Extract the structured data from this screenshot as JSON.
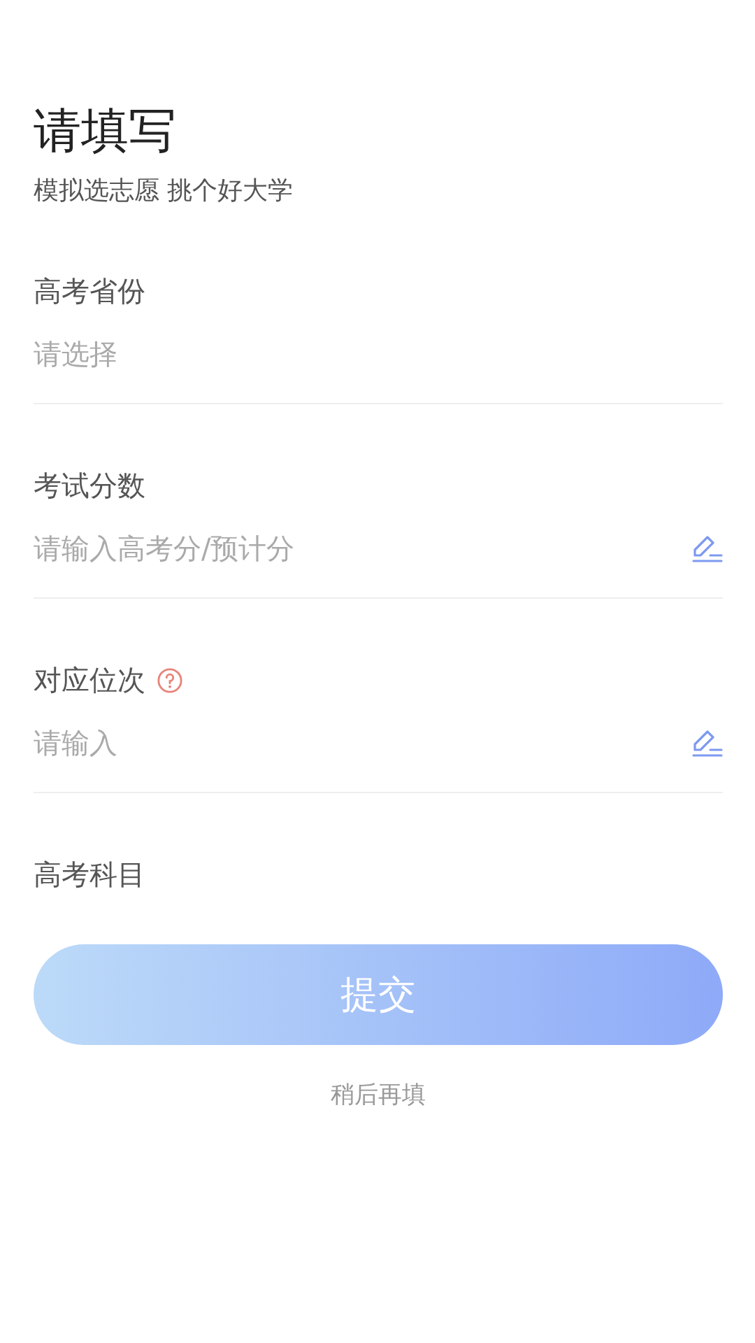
{
  "title": "请填写",
  "subtitle": "模拟选志愿 挑个好大学",
  "fields": [
    {
      "kind": "select",
      "label": "高考省份",
      "placeholder": "请选择",
      "help": false
    },
    {
      "kind": "input",
      "label": "考试分数",
      "placeholder": "请输入高考分/预计分",
      "help": false
    },
    {
      "kind": "input",
      "label": "对应位次",
      "placeholder": "请输入",
      "help": true
    },
    {
      "kind": "heading",
      "label": "高考科目",
      "help": false
    }
  ],
  "submit": {
    "label": "提交",
    "disabled": true
  },
  "later": "稍后再填"
}
